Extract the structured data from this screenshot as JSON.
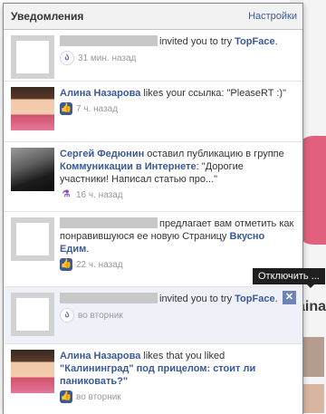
{
  "header": {
    "title": "Уведомления",
    "settings_link": "Настройки"
  },
  "background": {
    "partial_text": "aina"
  },
  "notifications": [
    {
      "actor": "",
      "action": "invited you to try",
      "target": "TopFace",
      "end": ".",
      "time": "31 мин. назад",
      "icon": "topface-icon"
    },
    {
      "actor": "Алина Назарова",
      "action": "likes your ссылка: \"PleaseRT :)\"",
      "time": "7 ч. назад",
      "icon": "like-icon"
    },
    {
      "actor": "Сергей Федюнин",
      "action": "оставил публикацию в группе",
      "target": "Коммуникации в Интернете",
      "end": ":",
      "quote": "\"Дорогие участники! Написал статью про...\"",
      "time": "16 ч. назад",
      "icon": "flask-icon"
    },
    {
      "actor": "",
      "action": "предлагает вам отметить как понравившуюся ее новую Страницу",
      "target": "Вкусно Едим",
      "end": ".",
      "time": "22 ч. назад",
      "icon": "like-icon"
    },
    {
      "actor": "",
      "action": "invited you to try",
      "target": "TopFace",
      "end": ".",
      "time": "во вторник",
      "icon": "topface-icon"
    },
    {
      "actor": "Алина Назарова",
      "action": "likes that you liked",
      "target": "\"Калининград\" под прицелом: стоит ли паниковать?\"",
      "end": ".",
      "time": "во вторник",
      "icon": "like-icon"
    }
  ],
  "tooltip": {
    "text": "Отключить ..."
  },
  "close_button": {
    "label": "✕"
  }
}
